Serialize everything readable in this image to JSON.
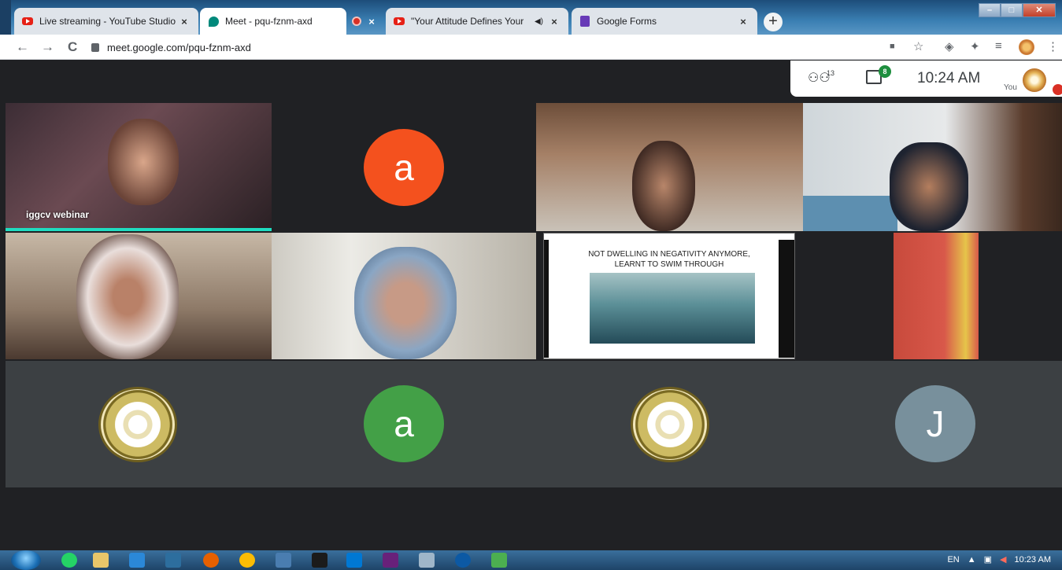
{
  "browser": {
    "tabs": [
      {
        "title": "Live streaming - YouTube Studio",
        "icon": "youtube-icon",
        "close": "×"
      },
      {
        "title": "Meet - pqu-fznm-axd",
        "icon": "meet-icon",
        "close": ""
      },
      {
        "title": "",
        "icon": "recording-icon",
        "close": "×"
      },
      {
        "title": "\"Your Attitude Defines Your",
        "icon": "youtube-icon",
        "close": "×"
      },
      {
        "title": "Google Forms",
        "icon": "google-forms-icon",
        "close": "×"
      }
    ],
    "new_tab": "+",
    "window_controls": {
      "minimize": "–",
      "maximize": "□",
      "close": "✕"
    },
    "url": "meet.google.com/pqu-fznm-axd",
    "nav": {
      "back": "←",
      "forward": "→",
      "reload": "C"
    },
    "toolbar_icons": {
      "camera": "■",
      "star": "☆",
      "extension1": "◈",
      "extensions": "✦",
      "media": "≡",
      "menu": "⋮"
    }
  },
  "meet": {
    "people_count": "13",
    "chat_badge": "8",
    "time": "10:24 AM",
    "you_label": "You",
    "tiles": [
      {
        "type": "video",
        "name": "iggcv webinar"
      },
      {
        "type": "avatar",
        "letter": "a",
        "color": "#f4511e"
      },
      {
        "type": "video",
        "name": ""
      },
      {
        "type": "video",
        "name": ""
      },
      {
        "type": "video",
        "name": ""
      },
      {
        "type": "video",
        "name": ""
      },
      {
        "type": "presentation",
        "lines": [
          "NOT DWELLING IN NEGATIVITY ANYMORE,",
          "LEARNT TO SWIM THROUGH"
        ]
      },
      {
        "type": "video",
        "name": ""
      },
      {
        "type": "seal"
      },
      {
        "type": "avatar",
        "letter": "a",
        "color": "#43a047"
      },
      {
        "type": "seal"
      },
      {
        "type": "avatar",
        "letter": "J",
        "color": "#78909c"
      }
    ]
  },
  "taskbar": {
    "language": "EN",
    "time": "10:23 AM"
  }
}
